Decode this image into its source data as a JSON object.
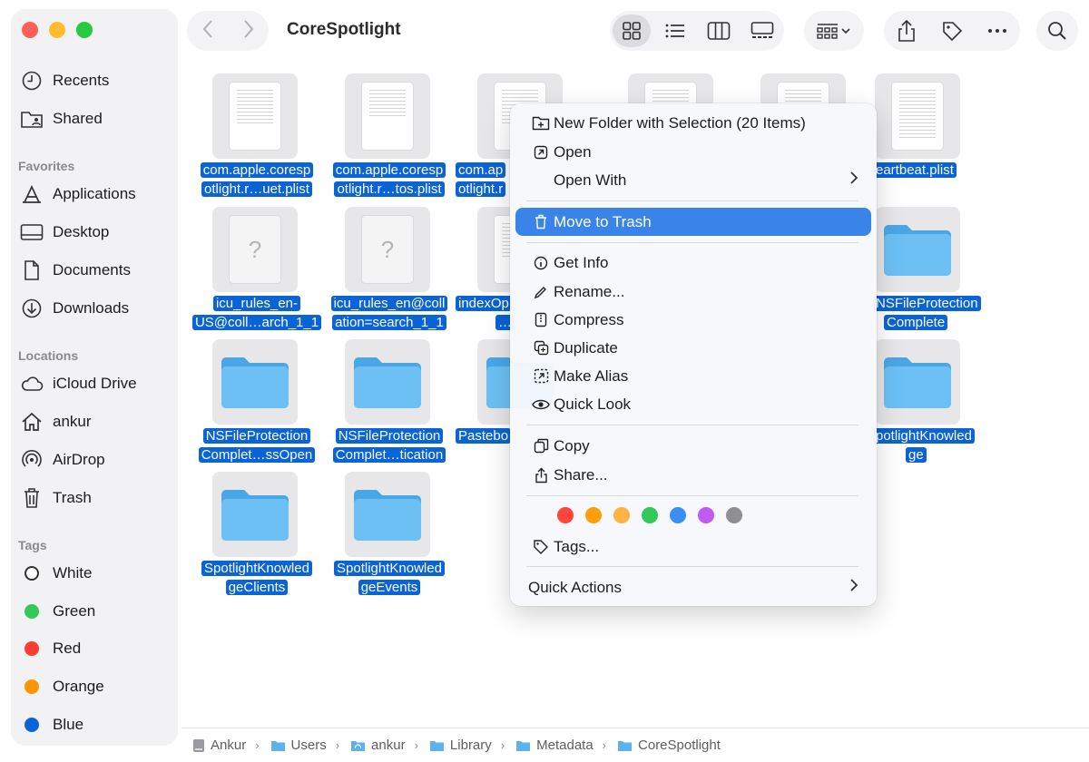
{
  "window": {
    "title": "CoreSpotlight"
  },
  "colors": {
    "accent": "#0a63d7",
    "menu_highlight": "#3a83e8",
    "traffic_close": "#ff5f57",
    "traffic_min": "#febc2e",
    "traffic_max": "#28c840",
    "folder_blue": "#5ab3ec"
  },
  "sidebar": {
    "top_items": [
      {
        "label": "Recents",
        "icon": "clock-icon"
      },
      {
        "label": "Shared",
        "icon": "shared-folder-icon"
      }
    ],
    "favorites_header": "Favorites",
    "favorites": [
      {
        "label": "Applications",
        "icon": "applications-icon"
      },
      {
        "label": "Desktop",
        "icon": "desktop-icon"
      },
      {
        "label": "Documents",
        "icon": "document-icon"
      },
      {
        "label": "Downloads",
        "icon": "download-icon"
      }
    ],
    "locations_header": "Locations",
    "locations": [
      {
        "label": "iCloud Drive",
        "icon": "cloud-icon"
      },
      {
        "label": "ankur",
        "icon": "home-icon"
      },
      {
        "label": "AirDrop",
        "icon": "airdrop-icon"
      },
      {
        "label": "Trash",
        "icon": "trash-icon"
      }
    ],
    "tags_header": "Tags",
    "tags": [
      {
        "label": "White",
        "color": "#ffffff"
      },
      {
        "label": "Green",
        "color": "#34c759"
      },
      {
        "label": "Red",
        "color": "#ff3b30"
      },
      {
        "label": "Orange",
        "color": "#ff9500"
      },
      {
        "label": "Blue",
        "color": "#0a63d7"
      }
    ]
  },
  "toolbar": {
    "back_icon": "chevron-left-icon",
    "forward_icon": "chevron-right-icon",
    "view_icons": [
      "grid-view-icon",
      "list-view-icon",
      "column-view-icon",
      "gallery-view-icon"
    ],
    "group_icon": "group-by-icon",
    "share_icon": "share-icon",
    "tag_icon": "tag-icon",
    "more_icon": "more-icon",
    "search_icon": "search-icon"
  },
  "files": [
    {
      "lines": [
        "com.apple.coresp",
        "otlight.r…uet.plist"
      ],
      "kind": "document"
    },
    {
      "lines": [
        "com.apple.coresp",
        "otlight.r…tos.plist"
      ],
      "kind": "document"
    },
    {
      "lines": [
        "com.ap",
        "otlight.r"
      ],
      "kind": "document"
    },
    {
      "lines": [
        "eartbeat.plist"
      ],
      "kind": "document"
    },
    {
      "lines": [
        "icu_rules_en-",
        "US@coll…arch_1_1"
      ],
      "kind": "unknown"
    },
    {
      "lines": [
        "icu_rules_en@coll",
        "ation=search_1_1"
      ],
      "kind": "unknown"
    },
    {
      "lines": [
        "indexOp",
        "…"
      ],
      "kind": "document"
    },
    {
      "lines": [
        "NSFileProtection",
        "Complete"
      ],
      "kind": "folder"
    },
    {
      "lines": [
        "NSFileProtection",
        "Complet…ssOpen"
      ],
      "kind": "folder"
    },
    {
      "lines": [
        "NSFileProtection",
        "Complet…tication"
      ],
      "kind": "folder"
    },
    {
      "lines": [
        "Pastebo"
      ],
      "kind": "folder"
    },
    {
      "lines": [
        "potlightKnowled",
        "ge"
      ],
      "kind": "folder"
    },
    {
      "lines": [
        "SpotlightKnowled",
        "geClients"
      ],
      "kind": "folder"
    },
    {
      "lines": [
        "SpotlightKnowled",
        "geEvents"
      ],
      "kind": "folder"
    }
  ],
  "context_menu": {
    "new_folder": "New Folder with Selection (20 Items)",
    "open": "Open",
    "open_with": "Open With",
    "move_to_trash": "Move to Trash",
    "get_info": "Get Info",
    "rename": "Rename...",
    "compress": "Compress",
    "duplicate": "Duplicate",
    "make_alias": "Make Alias",
    "quick_look": "Quick Look",
    "copy": "Copy",
    "share": "Share...",
    "tag_colors": [
      "#ff453a",
      "#ff9f0a",
      "#ffb340",
      "#34c759",
      "#3a8ff5",
      "#bf5af2",
      "#8e8e93"
    ],
    "tags": "Tags...",
    "quick_actions": "Quick Actions"
  },
  "pathbar": {
    "crumbs": [
      "Ankur",
      "Users",
      "ankur",
      "Library",
      "Metadata",
      "CoreSpotlight"
    ]
  }
}
